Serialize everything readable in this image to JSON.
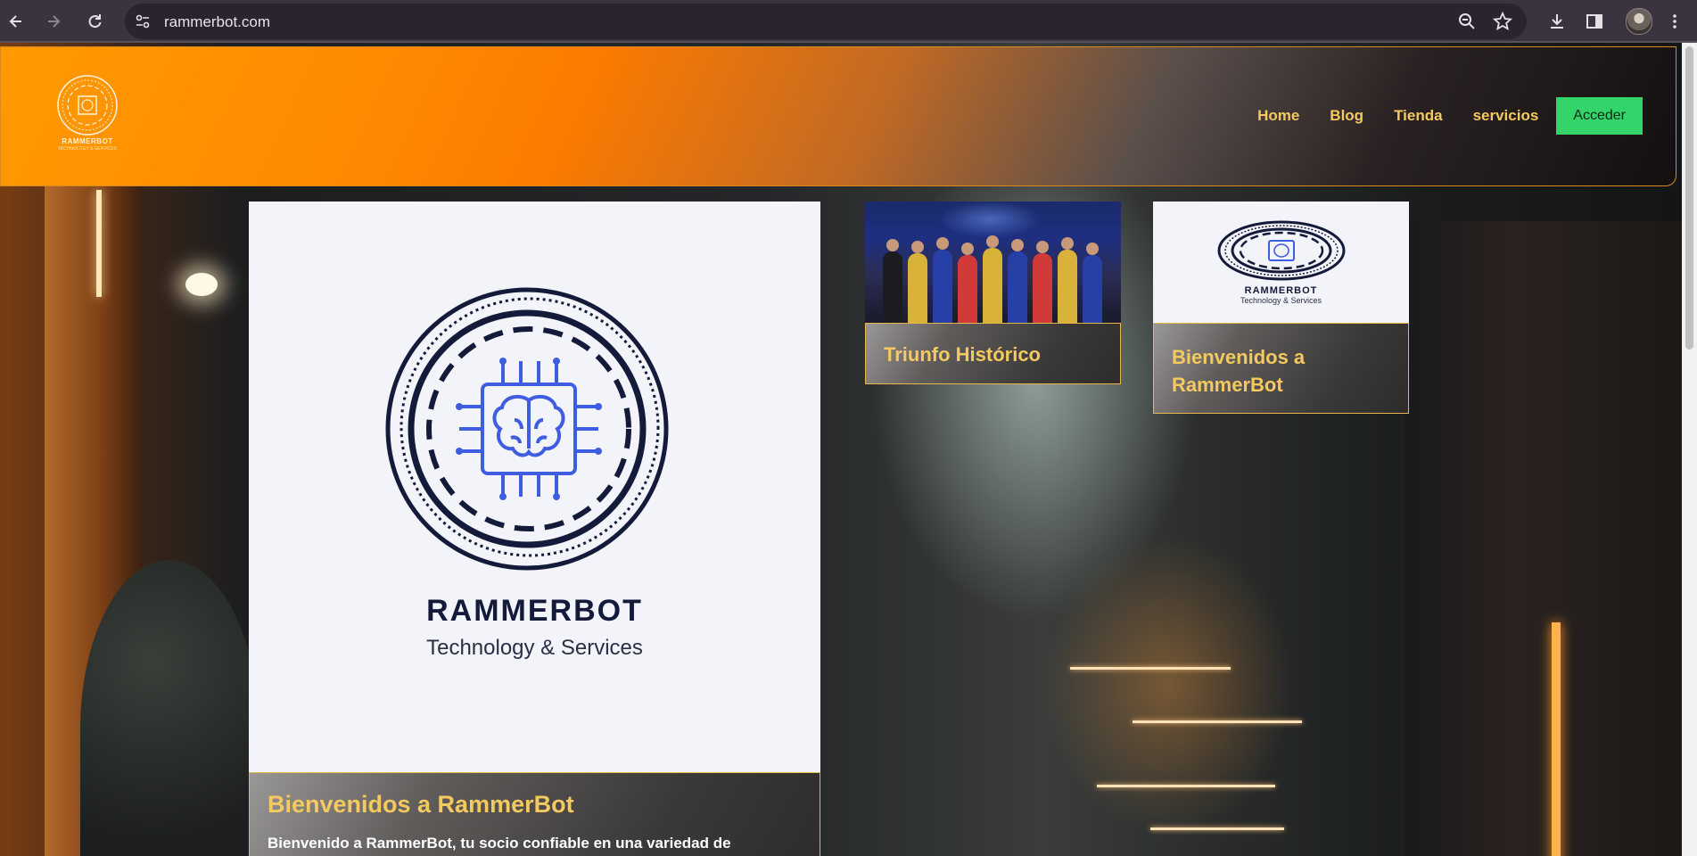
{
  "browser": {
    "url": "rammerbot.com",
    "icons": [
      "back-icon",
      "forward-icon",
      "reload-icon",
      "site-info-icon",
      "zoom-icon",
      "star-icon",
      "download-icon",
      "side-panel-icon",
      "profile-avatar",
      "menu-icon"
    ]
  },
  "header": {
    "logo": {
      "brand": "RAMMERBOT",
      "tagline": "TECHNOLOGY & SERVICES"
    },
    "nav": [
      {
        "label": "Home"
      },
      {
        "label": "Blog"
      },
      {
        "label": "Tienda"
      },
      {
        "label": "servicios"
      }
    ],
    "login_label": "Acceder",
    "colors": {
      "gradient_start": "#ff9a00",
      "gradient_end": "#141010",
      "accent_gold": "#f3c960",
      "login_green": "#33d46a"
    }
  },
  "cards": {
    "main": {
      "brand": "RAMMERBOT",
      "tagline": "Technology & Services",
      "title": "Bienvenidos a RammerBot",
      "excerpt": "Bienvenido a RammerBot, tu socio confiable en una variedad de"
    },
    "photo": {
      "title": "Triunfo Histórico"
    },
    "welcome": {
      "brand": "RAMMERBOT",
      "tagline": "Technology & Services",
      "title": "Bienvenidos a RammerBot"
    }
  }
}
